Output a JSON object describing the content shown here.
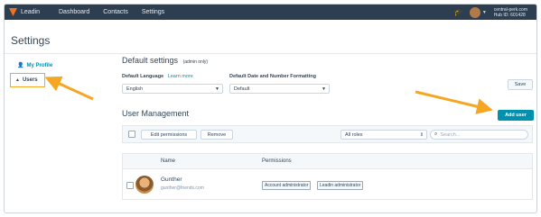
{
  "nav": {
    "brand": "Leadin",
    "items": [
      "Dashboard",
      "Contacts",
      "Settings"
    ],
    "portal_name": "central-perk.com",
    "hub_id": "Hub ID: 601428"
  },
  "page_title": "Settings",
  "sidebar": {
    "items": [
      {
        "label": "My Profile",
        "icon": "person-icon"
      },
      {
        "label": "Users",
        "icon": "users-icon",
        "selected": true
      }
    ]
  },
  "default_settings": {
    "title": "Default settings",
    "note": "(admin only)",
    "language_label": "Default Language",
    "learn_more": "Learn more",
    "language_value": "English",
    "date_label": "Default Date and Number Formatting",
    "date_value": "Default",
    "save_label": "Save"
  },
  "user_management": {
    "title": "User Management",
    "add_user_label": "Add user",
    "edit_permissions_label": "Edit permissions",
    "remove_label": "Remove",
    "roles_filter": "All roles",
    "search_placeholder": "Search...",
    "columns": [
      "Name",
      "Permissions"
    ],
    "rows": [
      {
        "name": "Gunther",
        "email": "gunther@friends.com",
        "permissions": [
          "Account administrator",
          "Leadin administrator"
        ]
      }
    ]
  },
  "colors": {
    "nav_bg": "#2d3e50",
    "accent": "#0091ae",
    "highlight": "#f5a623"
  }
}
